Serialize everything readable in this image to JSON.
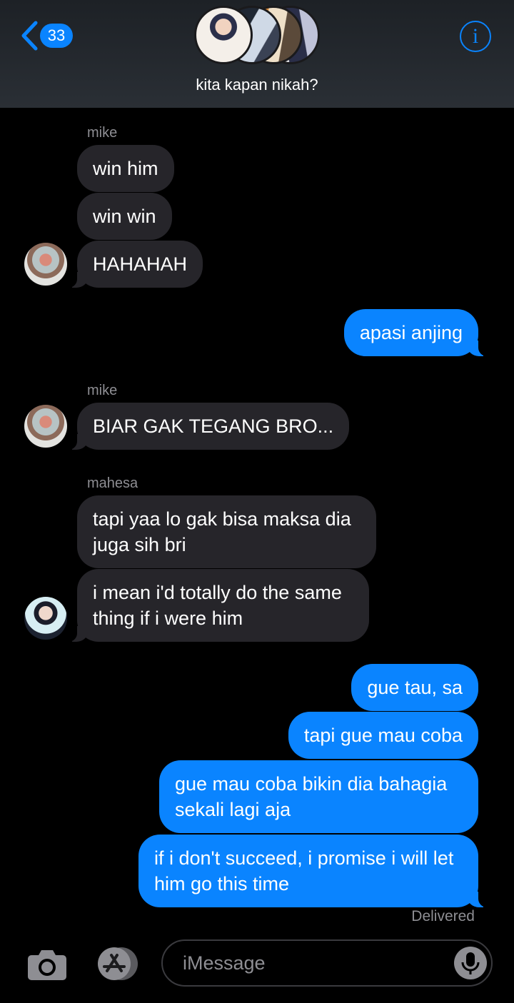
{
  "header": {
    "back_badge": "33",
    "info_label": "i",
    "group_name": "kita kapan nikah?"
  },
  "messages": [
    {
      "sender": "mike"
    },
    {
      "text": "win him"
    },
    {
      "text": "win win"
    },
    {
      "text": "HAHAHAH"
    },
    {
      "text": "apasi anjing"
    },
    {
      "sender": "mike"
    },
    {
      "text": "BIAR GAK TEGANG BRO..."
    },
    {
      "sender": "mahesa"
    },
    {
      "text": "tapi yaa lo gak bisa maksa dia juga sih bri"
    },
    {
      "text": "i mean i'd totally do the same thing if i were him"
    },
    {
      "text": "gue tau, sa"
    },
    {
      "text": "tapi gue mau coba"
    },
    {
      "text": "gue mau coba bikin dia bahagia sekali lagi aja"
    },
    {
      "text": "if i don't succeed, i promise i will let him go this time"
    }
  ],
  "status": {
    "delivered": "Delivered"
  },
  "composer": {
    "placeholder": "iMessage"
  },
  "colors": {
    "accent": "#0a84ff",
    "incoming": "#26252a",
    "background": "#000000"
  },
  "icons": [
    "back-chevron-icon",
    "info-icon",
    "camera-icon",
    "app-store-icon",
    "mic-icon"
  ]
}
